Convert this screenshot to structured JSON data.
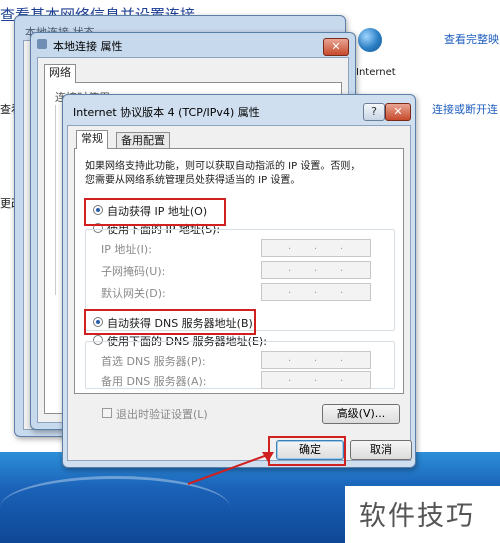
{
  "background": {
    "title": "查看基本网络信息并设置连接",
    "link_full_map": "查看完整映",
    "label_internet": "Internet",
    "label_view": "查看",
    "link_connect": "连接或断开连",
    "label_change": "更改"
  },
  "window1": {
    "title_partial": "本地连接 状态"
  },
  "window2": {
    "title": "本地连接 属性",
    "tab_network": "网络",
    "label_connect_using": "连接时使用:"
  },
  "dialog": {
    "title": "Internet 协议版本 4 (TCP/IPv4) 属性",
    "help_button": "?",
    "close_button": "✕",
    "tabs": [
      {
        "label": "常规",
        "active": true
      },
      {
        "label": "备用配置",
        "active": false
      }
    ],
    "description_line1": "如果网络支持此功能，则可以获取自动指派的 IP 设置。否则，",
    "description_line2": "您需要从网络系统管理员处获得适当的 IP 设置。",
    "auto_ip": "自动获得 IP 地址(O)",
    "manual_ip": "使用下面的 IP 地址(S):",
    "ip_address": "IP 地址(I):",
    "subnet_mask": "子网掩码(U):",
    "default_gateway": "默认网关(D):",
    "auto_dns": "自动获得 DNS 服务器地址(B)",
    "manual_dns": "使用下面的 DNS 服务器地址(E):",
    "preferred_dns": "首选 DNS 服务器(P):",
    "alternate_dns": "备用 DNS 服务器(A):",
    "validate_on_exit": "退出时验证设置(L)",
    "advanced_button": "高级(V)...",
    "ok_button": "确定",
    "cancel_button": "取消",
    "ip_dots": "."
  },
  "watermark": {
    "brand_text": "软件技巧"
  },
  "colors": {
    "highlight": "#d02020",
    "taskbar": "#1a62b8",
    "link": "#1f5fbf"
  }
}
